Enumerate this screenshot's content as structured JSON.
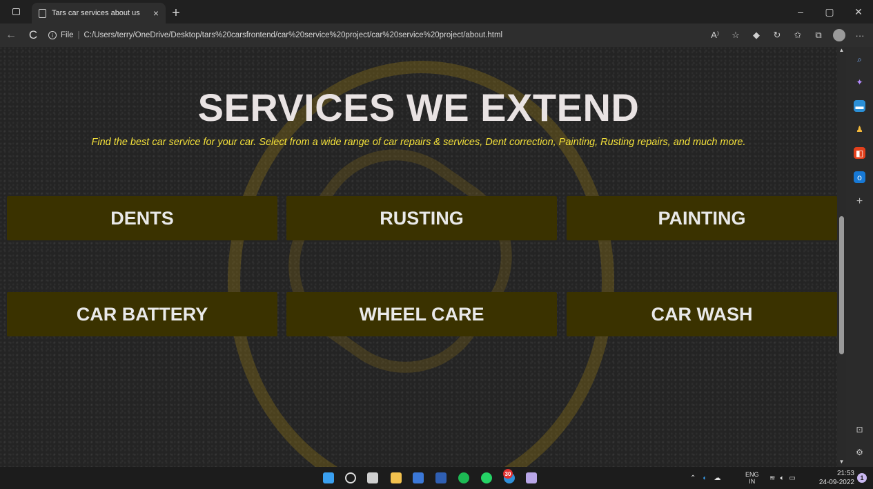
{
  "browser": {
    "tab_title": "Tars car services about us",
    "tab_close": "×",
    "new_tab": "+",
    "win_minimize": "–",
    "win_maximize": "▢",
    "win_close": "✕",
    "url_scheme_label": "File",
    "url_separator": "|",
    "url": "C:/Users/terry/OneDrive/Desktop/tars%20carsfrontend/car%20service%20project/car%20service%20project/about.html",
    "back_glyph": "←",
    "reload_glyph": "C",
    "more_glyph": "···"
  },
  "page": {
    "heading": "SERVICES WE EXTEND",
    "subtitle": "Find the best car service for your car. Select from a wide range of car repairs & services, Dent correction, Painting, Rusting repairs, and much more.",
    "services": [
      "DENTS",
      "RUSTING",
      "PAINTING",
      "CAR BATTERY",
      "WHEEL CARE",
      "CAR WASH"
    ],
    "colors": {
      "heading": "#e9e3e3",
      "subtitle": "#f3e03a",
      "service_bg": "#3a3200"
    }
  },
  "sidebar_icons": [
    "search-icon",
    "copilot-icon",
    "shopping-icon",
    "games-icon",
    "office-icon",
    "outlook-icon",
    "add-icon",
    "split-screen-icon",
    "settings-icon"
  ],
  "taskbar": {
    "whatsapp_badge": "30",
    "language_line1": "ENG",
    "language_line2": "IN",
    "time": "21:53",
    "date": "24-09-2022",
    "notification_count": "1"
  }
}
